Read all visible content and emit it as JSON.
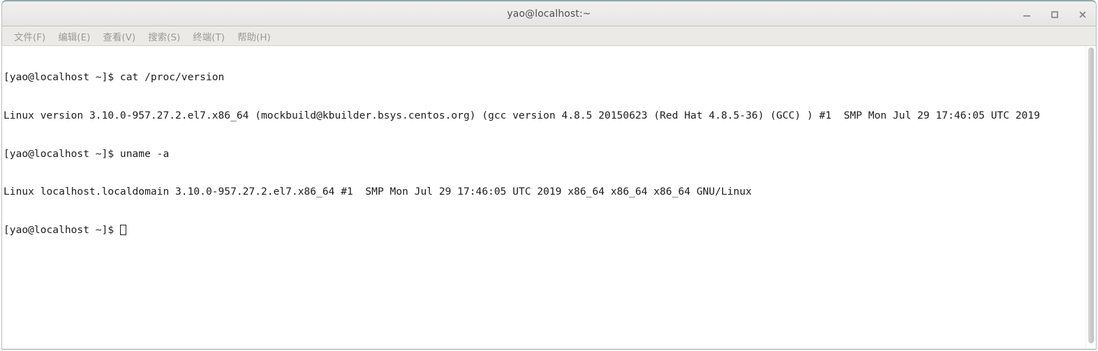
{
  "window": {
    "title": "yao@localhost:~",
    "controls": [
      {
        "name": "minimize-button",
        "label": "—"
      },
      {
        "name": "maximize-button",
        "label": "□"
      },
      {
        "name": "close-button",
        "label": "✕"
      }
    ]
  },
  "menubar": {
    "items": [
      {
        "label": "文件(F)"
      },
      {
        "label": "编辑(E)"
      },
      {
        "label": "查看(V)"
      },
      {
        "label": "搜索(S)"
      },
      {
        "label": "终端(T)"
      },
      {
        "label": "帮助(H)"
      }
    ]
  },
  "terminal": {
    "lines": [
      "[yao@localhost ~]$ cat /proc/version",
      "Linux version 3.10.0-957.27.2.el7.x86_64 (mockbuild@kbuilder.bsys.centos.org) (gcc version 4.8.5 20150623 (Red Hat 4.8.5-36) (GCC) ) #1  SMP Mon Jul 29 17:46:05 UTC 2019",
      "[yao@localhost ~]$ uname -a",
      "Linux localhost.localdomain 3.10.0-957.27.2.el7.x86_64 #1  SMP Mon Jul 29 17:46:05 UTC 2019 x86_64 x86_64 x86_64 GNU/Linux",
      "[yao@localhost ~]$ "
    ],
    "prompt": "[yao@localhost ~]$ ",
    "cursor": "block-outline"
  },
  "colors": {
    "titlebar_bg": "#eceaea",
    "titlebar_accent": "#8fa9ab",
    "menubar_bg": "#eceae6",
    "terminal_bg": "#ffffff",
    "terminal_fg": "#1c1c1c",
    "menu_text": "#9a9a98"
  }
}
